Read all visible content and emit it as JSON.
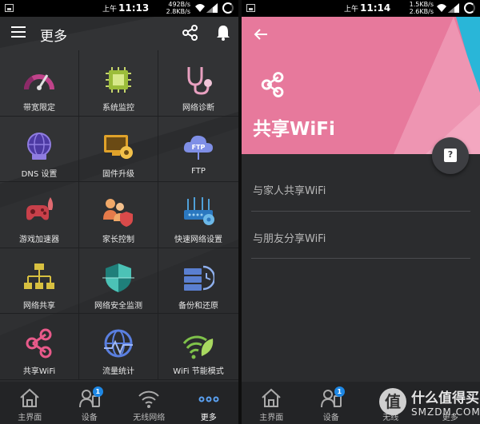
{
  "left_screen": {
    "status": {
      "ampm": "上午",
      "time": "11:13",
      "up": "492B/s",
      "down": "2.8KB/s"
    },
    "appbar": {
      "title": "更多"
    },
    "tiles": [
      {
        "label": "带宽限定",
        "icon": "gauge-icon"
      },
      {
        "label": "系统监控",
        "icon": "chip-icon"
      },
      {
        "label": "网络诊断",
        "icon": "stethoscope-icon"
      },
      {
        "label": "DNS 设置",
        "icon": "dns-globe-icon"
      },
      {
        "label": "固件升级",
        "icon": "firmware-icon"
      },
      {
        "label": "FTP",
        "icon": "ftp-cloud-icon"
      },
      {
        "label": "游戏加速器",
        "icon": "gamepad-rocket-icon"
      },
      {
        "label": "家长控制",
        "icon": "parental-icon"
      },
      {
        "label": "快速网络设置",
        "icon": "router-icon"
      },
      {
        "label": "网络共享",
        "icon": "network-tree-icon"
      },
      {
        "label": "网络安全监测",
        "icon": "shield-icon"
      },
      {
        "label": "备份和还原",
        "icon": "backup-icon"
      },
      {
        "label": "共享WiFi",
        "icon": "share-icon"
      },
      {
        "label": "流量统计",
        "icon": "traffic-globe-icon"
      },
      {
        "label": "WiFi 节能模式",
        "icon": "wifi-leaf-icon"
      }
    ],
    "nav": [
      {
        "label": "主界面",
        "icon": "home-icon"
      },
      {
        "label": "设备",
        "icon": "devices-icon",
        "badge": "1"
      },
      {
        "label": "无线网络",
        "icon": "wifi-icon"
      },
      {
        "label": "更多",
        "icon": "more-icon"
      }
    ]
  },
  "right_screen": {
    "status": {
      "ampm": "上午",
      "time": "11:14",
      "up": "1.5KB/s",
      "down": "2.6KB/s"
    },
    "header": {
      "title": "共享WiFi"
    },
    "items": [
      {
        "label": "与家人共享WiFi"
      },
      {
        "label": "与朋友分享WiFi"
      }
    ],
    "nav": [
      {
        "label": "主界面"
      },
      {
        "label": "设备",
        "badge": "1"
      },
      {
        "label": "无线"
      },
      {
        "label": "更多"
      }
    ]
  },
  "watermark": {
    "logo": "值",
    "main": "什么值得买",
    "sub": "SMZDM.COM"
  },
  "colors": {
    "header_pink": "#e7799c",
    "accent_blue": "#1e88e5",
    "cyan": "#29b6d8"
  }
}
